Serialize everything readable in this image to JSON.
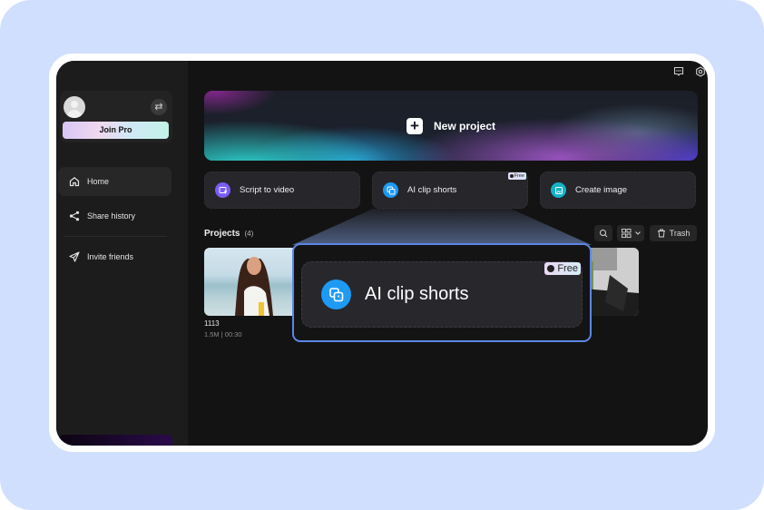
{
  "sidebar": {
    "join_pro_label": "Join Pro",
    "switch_icon": "swap-arrows-icon",
    "items": [
      {
        "label": "Home",
        "icon": "home-icon",
        "active": true
      },
      {
        "label": "Share history",
        "icon": "share-icon",
        "active": false
      },
      {
        "label": "Invite friends",
        "icon": "paper-plane-icon",
        "active": false
      }
    ]
  },
  "topbar": {
    "icons": [
      "feedback-icon",
      "settings-gear-icon"
    ]
  },
  "banner": {
    "label": "New project",
    "icon": "plus-icon"
  },
  "features": [
    {
      "label": "Script to video",
      "icon": "script-video-icon",
      "color": "#7b5cf5",
      "badge": null
    },
    {
      "label": "AI clip shorts",
      "icon": "ai-clip-icon",
      "color": "#1e9af5",
      "badge": "Free"
    },
    {
      "label": "Create image",
      "icon": "image-icon",
      "color": "#14b3c8",
      "badge": null
    }
  ],
  "projects": {
    "title": "Projects",
    "count": "(4)",
    "trash_label": "Trash",
    "items": [
      {
        "name": "1113",
        "meta": "1.5M | 00:30"
      }
    ]
  },
  "callout": {
    "label": "AI clip shorts",
    "badge": "Free"
  },
  "colors": {
    "background": "#d1dffe",
    "accent_border": "#5c87e6",
    "app_bg": "#131313",
    "sidebar_bg": "#1c1c1c"
  }
}
